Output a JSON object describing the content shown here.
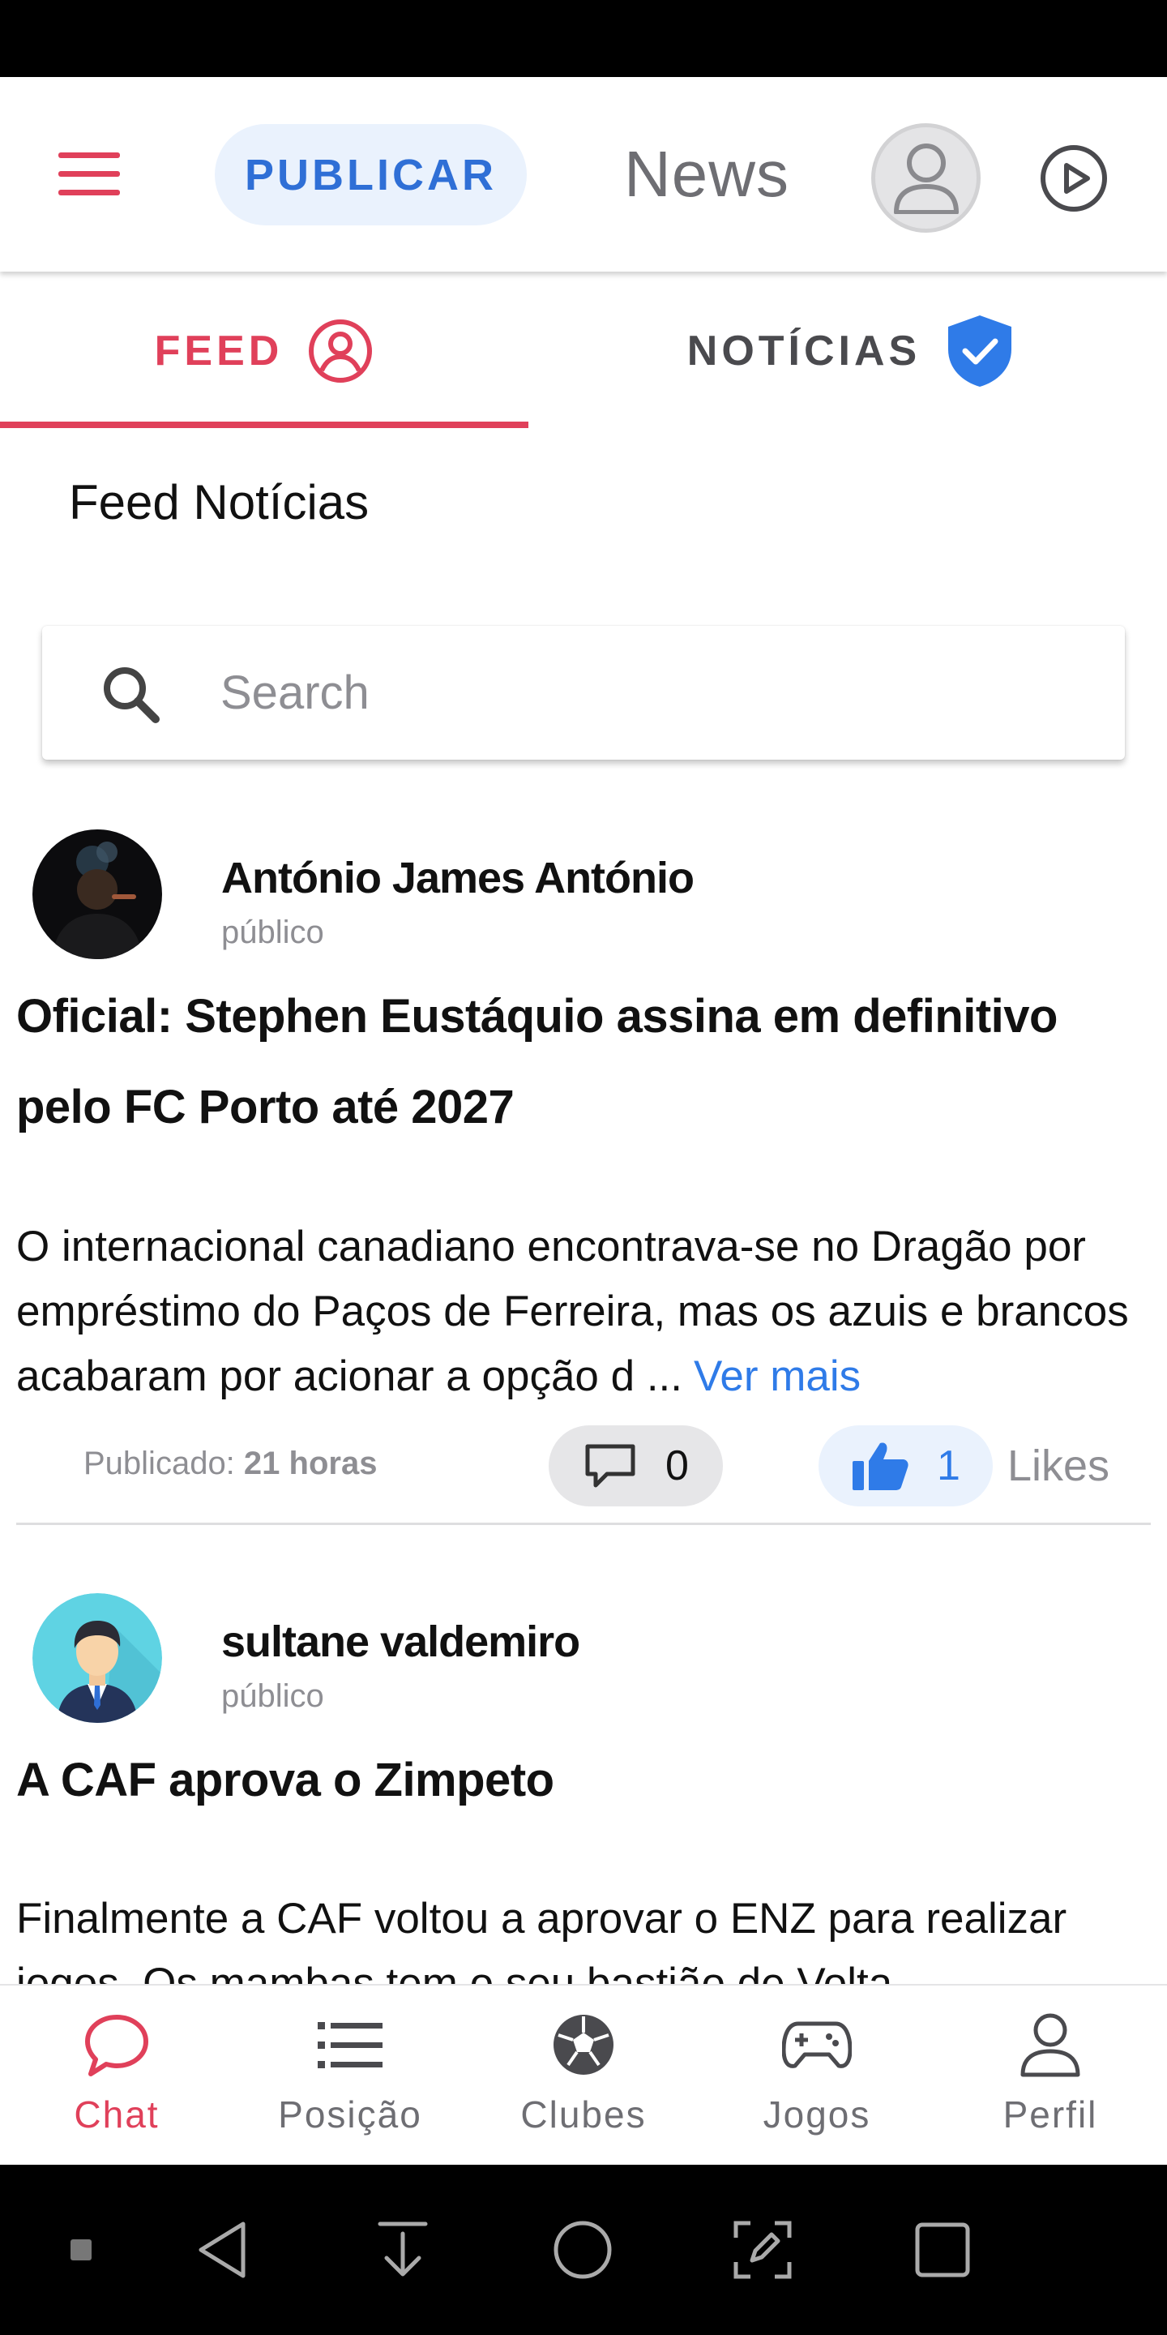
{
  "header": {
    "publish_label": "PUBLICAR",
    "brand_title": "News"
  },
  "tabs": [
    {
      "label": "FEED",
      "active": true
    },
    {
      "label": "NOTÍCIAS",
      "active": false
    }
  ],
  "section_title": "Feed Notícias",
  "search": {
    "placeholder": "Search",
    "value": ""
  },
  "posts": [
    {
      "author": "António James António",
      "visibility": "público",
      "title": "Oficial: Stephen Eustáquio assina em definitivo pelo FC Porto até 2027",
      "body": "O internacional canadiano encontrava-se no Dragão por empréstimo do Paços de Ferreira, mas os azuis e brancos acabaram por acionar a opção d ...",
      "see_more": "Ver mais",
      "published_label": "Publicado:",
      "published_time": "21 horas",
      "comments": "0",
      "likes": "1",
      "likes_label": "Likes"
    },
    {
      "author": "sultane valdemiro",
      "visibility": "público",
      "title": "A CAF aprova o Zimpeto",
      "body": "Finalmente a CAF voltou a aprovar o ENZ para realizar jogos. Os mambas tem o seu bastião de Volta"
    }
  ],
  "bottom_nav": [
    {
      "label": "Chat",
      "icon": "chat-bubble-icon",
      "active": true
    },
    {
      "label": "Posição",
      "icon": "list-icon",
      "active": false
    },
    {
      "label": "Clubes",
      "icon": "soccer-ball-icon",
      "active": false
    },
    {
      "label": "Jogos",
      "icon": "gamepad-icon",
      "active": false
    },
    {
      "label": "Perfil",
      "icon": "person-icon",
      "active": false
    }
  ],
  "colors": {
    "accent": "#e0405a",
    "primary_blue": "#2f7be8",
    "publish_bg": "#eaf2fd",
    "muted_text": "#8e8e93"
  }
}
